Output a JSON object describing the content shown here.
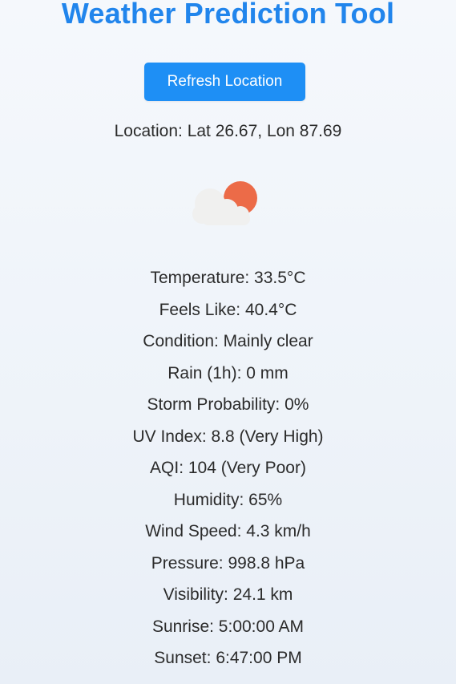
{
  "header": {
    "title": "Weather Prediction Tool"
  },
  "actions": {
    "refresh_label": "Refresh Location"
  },
  "location": {
    "text": "Location: Lat 26.67, Lon 87.69"
  },
  "weather_icon": {
    "name": "partly-sunny-icon",
    "sun_color": "#ec6b48",
    "cloud_color": "#f0f0ef"
  },
  "readings": [
    "Temperature: 33.5°C",
    "Feels Like: 40.4°C",
    "Condition: Mainly clear",
    "Rain (1h): 0 mm",
    "Storm Probability: 0%",
    "UV Index: 8.8 (Very High)",
    "AQI: 104 (Very Poor)",
    "Humidity: 65%",
    "Wind Speed: 4.3 km/h",
    "Pressure: 998.8 hPa",
    "Visibility: 24.1 km",
    "Sunrise: 5:00:00 AM",
    "Sunset: 6:47:00 PM"
  ],
  "colors": {
    "accent": "#2185ec",
    "button": "#1e8ff5",
    "text": "#2b2b2b"
  }
}
